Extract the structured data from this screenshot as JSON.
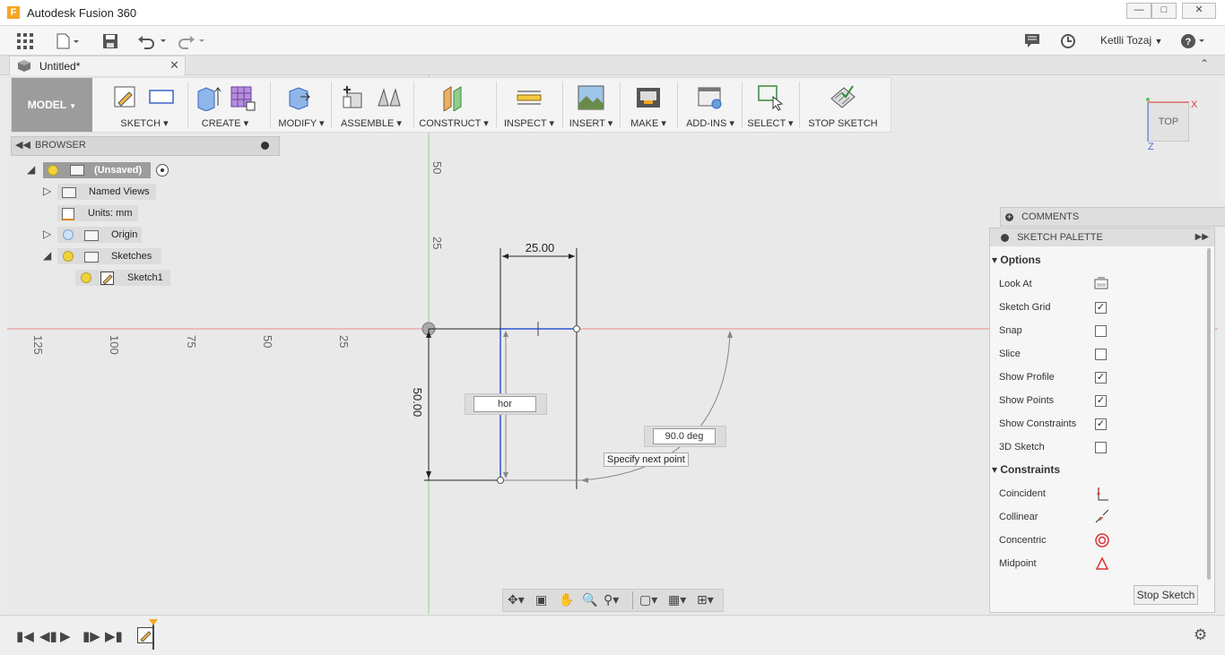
{
  "window": {
    "title": "Autodesk Fusion 360",
    "app_icon": "F"
  },
  "quick_toolbar": {
    "user": "Ketlli Tozaj"
  },
  "doc_tab": {
    "title": "Untitled*"
  },
  "ribbon": {
    "mode": "MODEL",
    "groups": [
      {
        "label": "SKETCH"
      },
      {
        "label": "CREATE"
      },
      {
        "label": "MODIFY"
      },
      {
        "label": "ASSEMBLE"
      },
      {
        "label": "CONSTRUCT"
      },
      {
        "label": "INSPECT"
      },
      {
        "label": "INSERT"
      },
      {
        "label": "MAKE"
      },
      {
        "label": "ADD-INS"
      },
      {
        "label": "SELECT"
      },
      {
        "label": "STOP SKETCH"
      }
    ]
  },
  "browser": {
    "title": "BROWSER",
    "root": "(Unsaved)",
    "named_views": "Named Views",
    "units": "Units: mm",
    "origin": "Origin",
    "sketches": "Sketches",
    "sketch1": "Sketch1"
  },
  "canvas": {
    "ruler_h": [
      "125",
      "100",
      "75",
      "50",
      "25"
    ],
    "ruler_v": [
      "50",
      "25"
    ],
    "dim_width": "25.00",
    "dim_height": "50.00",
    "input_value": "hor",
    "angle_value": "90.0 deg",
    "tooltip": "Specify next point"
  },
  "viewcube": {
    "label": "TOP",
    "axis_x": "X",
    "axis_z": "Z"
  },
  "comments": {
    "label": "COMMENTS"
  },
  "palette": {
    "title": "SKETCH PALETTE",
    "options_title": "Options",
    "options": [
      {
        "label": "Look At",
        "checked": null
      },
      {
        "label": "Sketch Grid",
        "checked": true
      },
      {
        "label": "Snap",
        "checked": false
      },
      {
        "label": "Slice",
        "checked": false
      },
      {
        "label": "Show Profile",
        "checked": true
      },
      {
        "label": "Show Points",
        "checked": true
      },
      {
        "label": "Show Constraints",
        "checked": true
      },
      {
        "label": "3D Sketch",
        "checked": false
      }
    ],
    "constraints_title": "Constraints",
    "constraints": [
      {
        "label": "Coincident",
        "icon": "coincident-icon"
      },
      {
        "label": "Collinear",
        "icon": "collinear-icon"
      },
      {
        "label": "Concentric",
        "icon": "concentric-icon"
      },
      {
        "label": "Midpoint",
        "icon": "midpoint-icon"
      }
    ],
    "stop_button": "Stop Sketch"
  },
  "colors": {
    "accent_red": "#e03c3c",
    "accent_green": "#5bc15b",
    "sketch_blue": "#2f56d6",
    "model_button": "#9c9c9c"
  }
}
